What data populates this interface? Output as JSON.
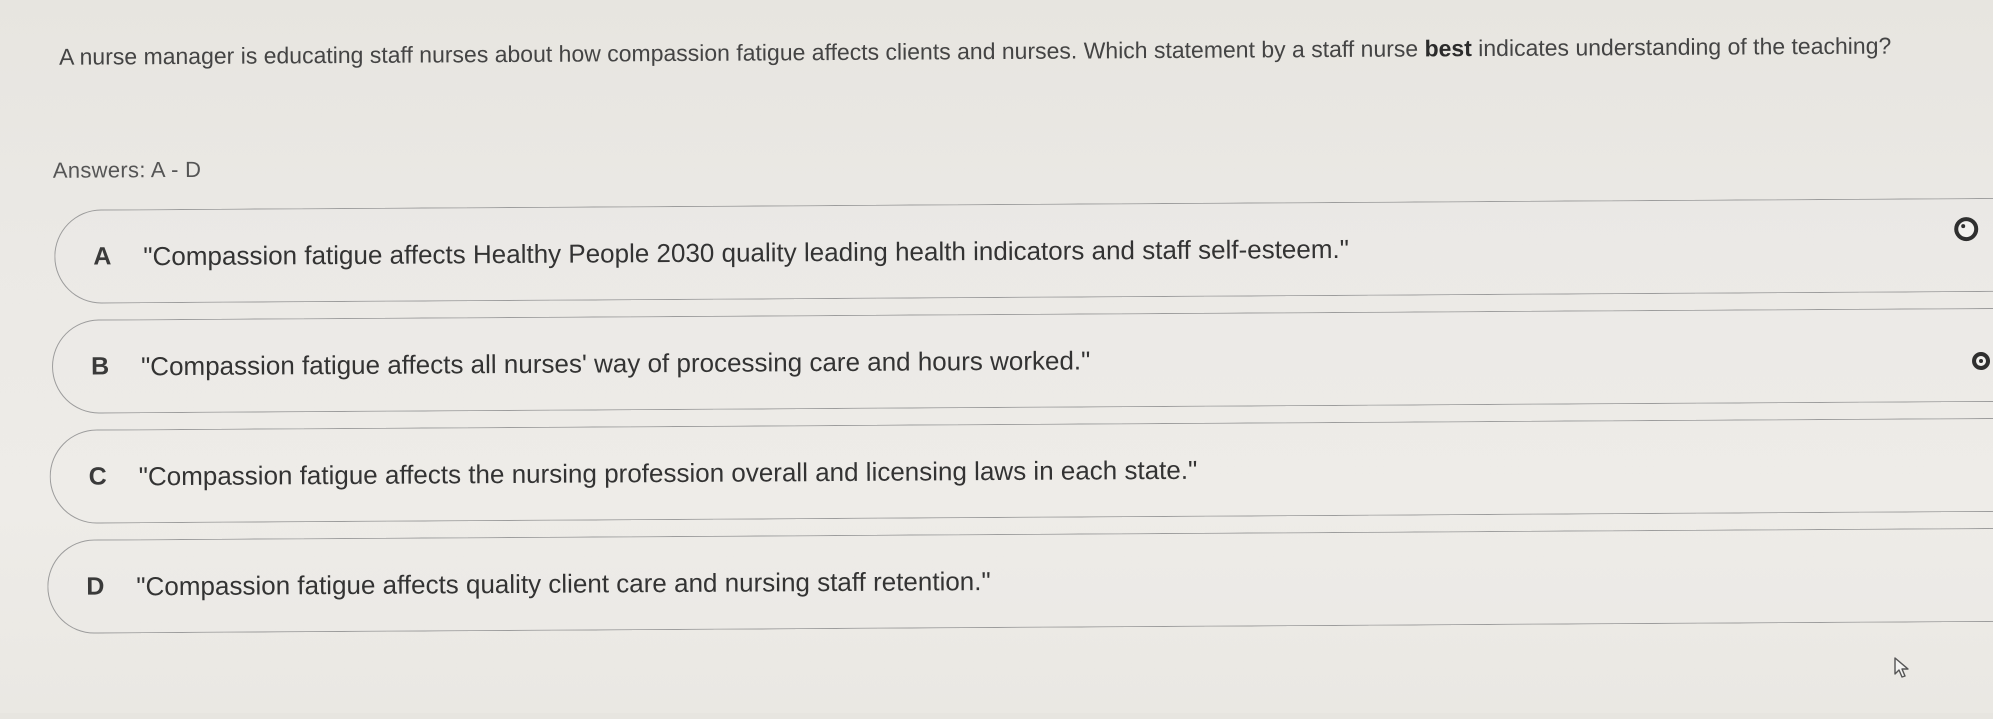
{
  "question": {
    "text_before": "A nurse manager is educating staff nurses about how compassion fatigue affects clients and nurses. Which statement by a staff nurse ",
    "emphasis": "best",
    "text_after": " indicates understanding of the teaching?"
  },
  "answers_label": "Answers: A - D",
  "options": [
    {
      "letter": "A",
      "text": "\"Compassion fatigue affects Healthy People 2030 quality leading health indicators and staff self-esteem.\""
    },
    {
      "letter": "B",
      "text": "\"Compassion fatigue affects all nurses' way of processing care and hours worked.\""
    },
    {
      "letter": "C",
      "text": "\"Compassion fatigue affects the nursing profession overall and licensing laws in each state.\""
    },
    {
      "letter": "D",
      "text": "\"Compassion fatigue affects quality client care and nursing staff retention.\""
    }
  ],
  "icons": {
    "radio": "radio-button-icon",
    "cursor": "mouse-pointer-icon"
  },
  "colors": {
    "text": "#3d3d3d",
    "border": "#9c9c9c",
    "background": "#ebe9e5"
  }
}
